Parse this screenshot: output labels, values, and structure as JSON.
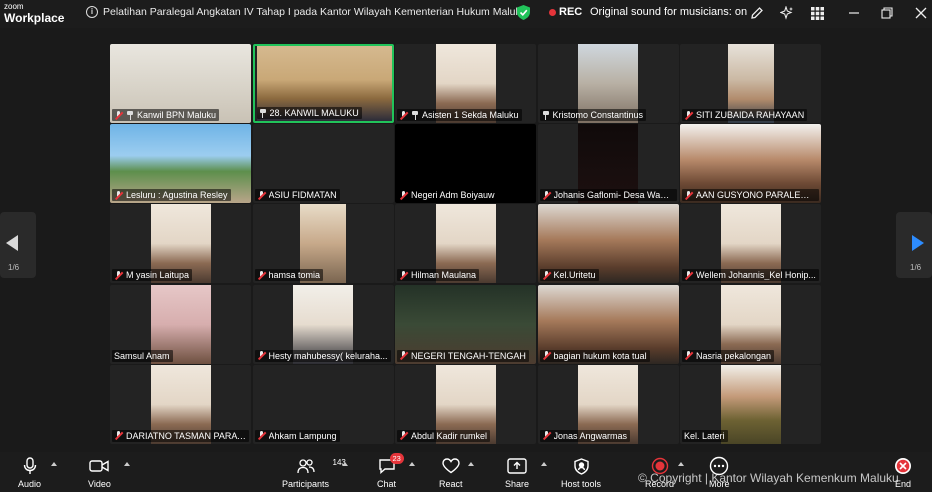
{
  "app": {
    "logo_line1": "zoom",
    "logo_line2": "Workplace"
  },
  "titlebar": {
    "meeting_title": "Pelatihan Paralegal Angkatan IV Tahap I pada Kantor Wilayah Kementerian Hukum Maluku",
    "rec_label": "REC",
    "original_sound": "Original sound for musicians: on",
    "icons": [
      "info-icon",
      "security-shield-icon",
      "pencil-icon",
      "sparkle-icon",
      "grid-icon",
      "minimize-icon",
      "restore-icon",
      "close-icon"
    ]
  },
  "gallery": {
    "page_indicator_left": "1/6",
    "page_indicator_right": "1/6",
    "tiles": [
      {
        "name": "Kanwil BPN Maluku",
        "muted": true,
        "pinned": true,
        "photo": "office"
      },
      {
        "name": "28. KANWIL MALUKU",
        "muted": false,
        "pinned": true,
        "photo": "stage",
        "active": true
      },
      {
        "name": "Asisten 1 Sekda Maluku",
        "muted": true,
        "pinned": true,
        "photo": "person-light"
      },
      {
        "name": "Kristomo Constantinus",
        "muted": false,
        "pinned": true,
        "photo": "outdoor"
      },
      {
        "name": "SITI ZUBAIDA RAHAYAAN",
        "muted": true,
        "pinned": false,
        "photo": "hijab"
      },
      {
        "name": "Lesluru : Agustina Resley",
        "muted": true,
        "pinned": false,
        "photo": "beach"
      },
      {
        "name": "ASIU FIDMATAN",
        "muted": true,
        "pinned": false,
        "photo": "none"
      },
      {
        "name": "Negeri Adm Boiyauw",
        "muted": true,
        "pinned": false,
        "photo": "black"
      },
      {
        "name": "Johanis Gaflomi- Desa Wabl...",
        "muted": true,
        "pinned": false,
        "photo": "dark"
      },
      {
        "name": "AAN GUSYONO PARALEGAL...",
        "muted": true,
        "pinned": false,
        "photo": "closeup"
      },
      {
        "name": "M yasin Laitupa",
        "muted": true,
        "pinned": false,
        "photo": "person-light"
      },
      {
        "name": "hamsa tomia",
        "muted": true,
        "pinned": false,
        "photo": "person-old"
      },
      {
        "name": "Hilman Maulana",
        "muted": true,
        "pinned": false,
        "photo": "person-light"
      },
      {
        "name": "Kel.Uritetu",
        "muted": true,
        "pinned": false,
        "photo": "closeup-wide"
      },
      {
        "name": "Wellem Johannis_Kel Honip...",
        "muted": true,
        "pinned": false,
        "photo": "person-light"
      },
      {
        "name": "Samsul Anam",
        "muted": false,
        "pinned": false,
        "photo": "person-pink"
      },
      {
        "name": "Hesty mahubessy( keluraha...",
        "muted": true,
        "pinned": false,
        "photo": "hijab-light"
      },
      {
        "name": "NEGERI TENGAH-TENGAH",
        "muted": true,
        "pinned": false,
        "photo": "dark-green"
      },
      {
        "name": "bagian hukum kota tual",
        "muted": true,
        "pinned": false,
        "photo": "closeup-wide"
      },
      {
        "name": "Nasria pekalongan",
        "muted": true,
        "pinned": false,
        "photo": "person-light"
      },
      {
        "name": "DARIATNO TASMAN  PARA ...",
        "muted": true,
        "pinned": false,
        "photo": "person-light"
      },
      {
        "name": "Ahkam Lampung",
        "muted": true,
        "pinned": false,
        "photo": "none"
      },
      {
        "name": "Abdul Kadir rumkel",
        "muted": true,
        "pinned": false,
        "photo": "person-light"
      },
      {
        "name": "Jonas Angwarmas",
        "muted": true,
        "pinned": false,
        "photo": "person-light"
      },
      {
        "name": "Kel. Lateri",
        "muted": false,
        "pinned": false,
        "photo": "person-uniform"
      }
    ]
  },
  "toolbar": {
    "audio": "Audio",
    "video": "Video",
    "participants": "Participants",
    "participants_count": "143",
    "chat": "Chat",
    "chat_badge": "23",
    "react": "React",
    "share": "Share",
    "host_tools": "Host tools",
    "record": "Record",
    "more": "More",
    "end": "End"
  },
  "watermark": "© Copyright | Kantor Wilayah Kemenkum Maluku",
  "colors": {
    "accent_blue": "#2d8cff",
    "rec_red": "#e5343a",
    "active_green": "#21c35a",
    "tile_bg": "#232323",
    "shield_green": "#21c35a"
  }
}
